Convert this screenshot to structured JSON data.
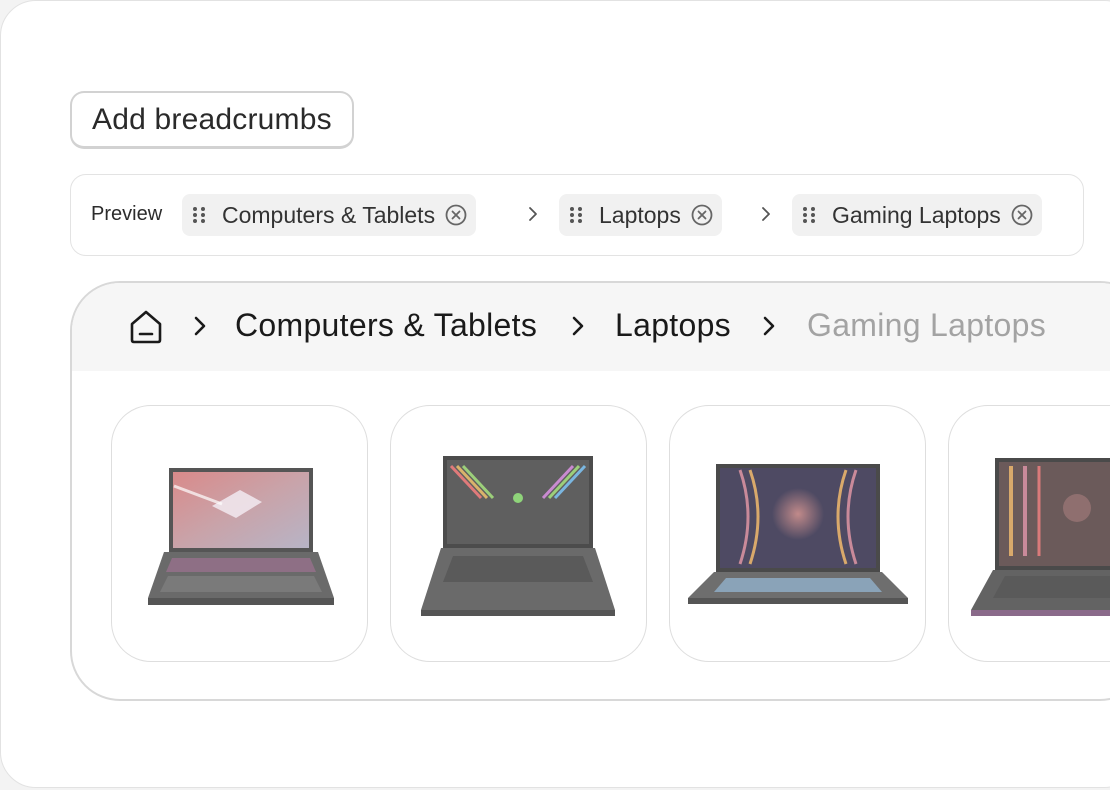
{
  "add_button": {
    "label": "Add breadcrumbs"
  },
  "preview": {
    "label": "Preview",
    "chips": [
      {
        "label": "Computers & Tablets"
      },
      {
        "label": "Laptops"
      },
      {
        "label": "Gaming Laptops"
      }
    ]
  },
  "breadcrumb": {
    "items": [
      {
        "label": "Computers & Tablets"
      },
      {
        "label": "Laptops"
      },
      {
        "label": "Gaming Laptops"
      }
    ]
  },
  "products": [
    {
      "image": "laptop-rog-image"
    },
    {
      "image": "laptop-razer-image"
    },
    {
      "image": "laptop-msi-image"
    },
    {
      "image": "laptop-msi-pro-image"
    }
  ],
  "colors": {
    "chip_bg": "#f1f1f1",
    "crumb_current": "#a3a3a3",
    "crumbbar_bg": "#f6f6f6"
  }
}
